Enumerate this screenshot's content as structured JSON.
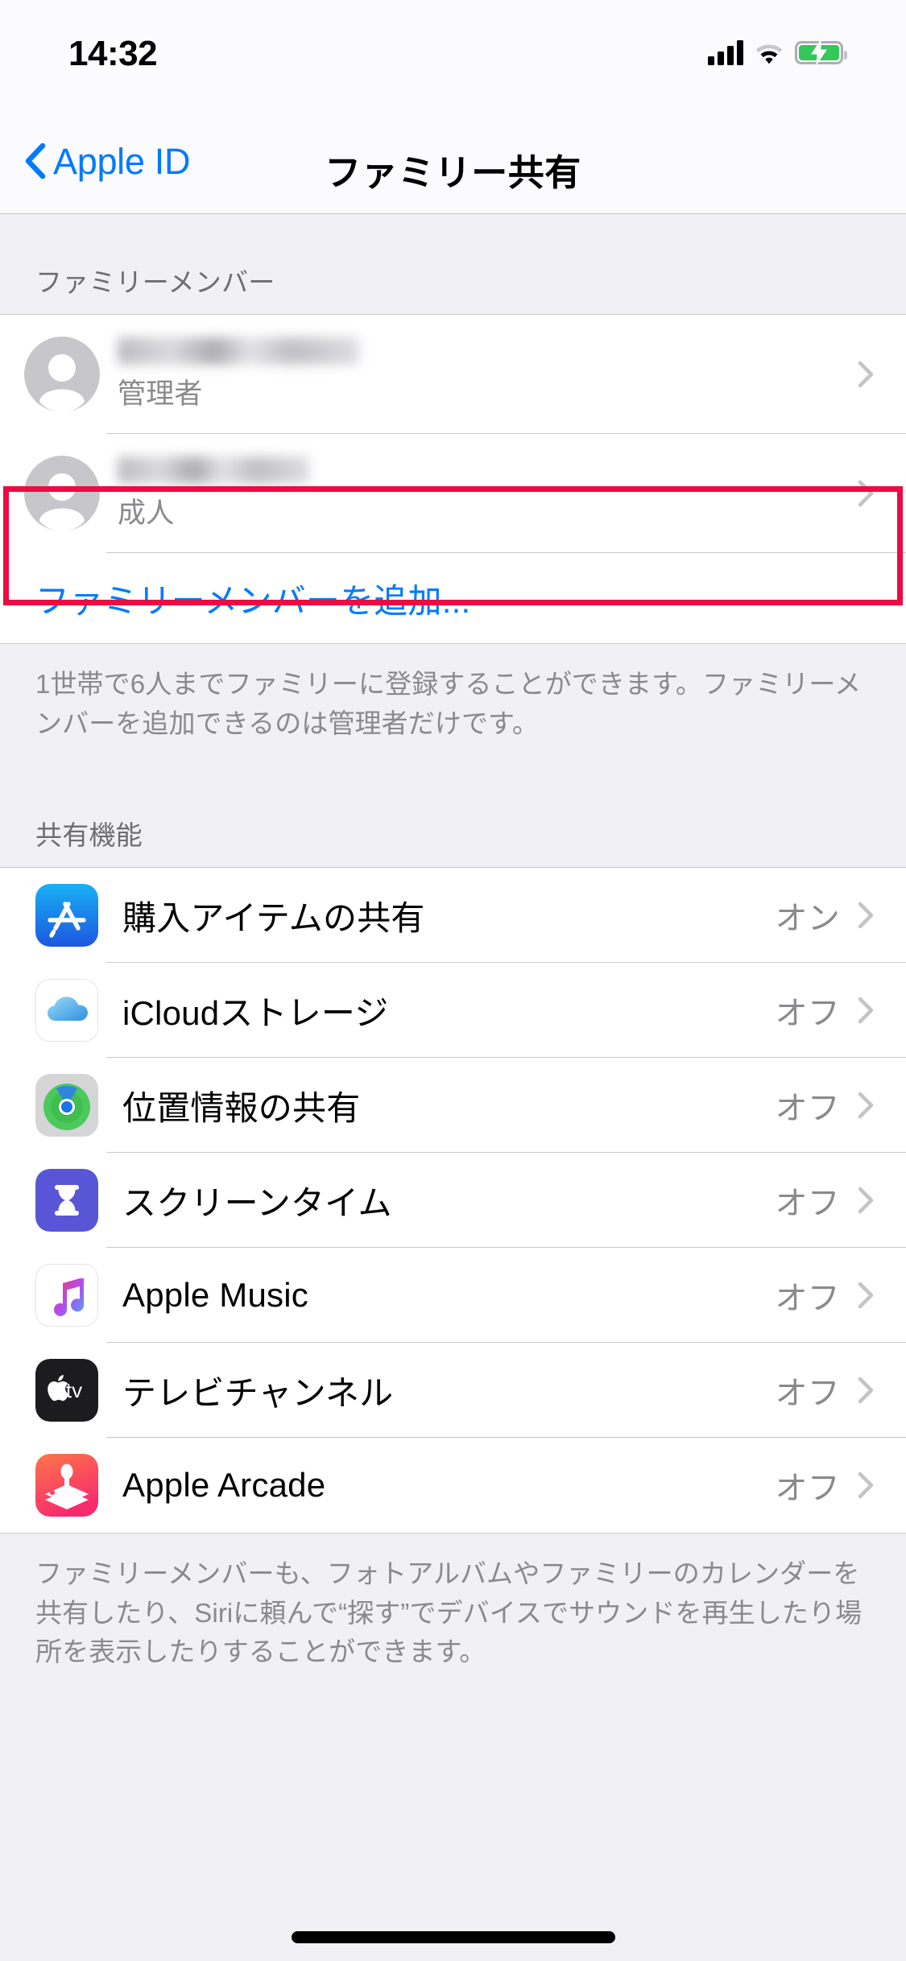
{
  "status_bar": {
    "time": "14:32",
    "signal_icon": "cellular-signal-icon",
    "wifi_icon": "wifi-icon",
    "battery_icon": "battery-charging-icon",
    "battery_charging": true
  },
  "nav": {
    "back_label": "Apple ID",
    "back_icon": "chevron-left-icon",
    "title": "ファミリー共有"
  },
  "members_section": {
    "header": "ファミリーメンバー",
    "members": [
      {
        "name_redacted": true,
        "role": "管理者",
        "avatar_icon": "person-avatar-icon",
        "chevron_icon": "chevron-right-icon",
        "highlighted": false
      },
      {
        "name_redacted": true,
        "role": "成人",
        "avatar_icon": "person-avatar-icon",
        "chevron_icon": "chevron-right-icon",
        "highlighted": true
      }
    ],
    "add_member_label": "ファミリーメンバーを追加...",
    "footer": "1世帯で6人までファミリーに登録することができます。ファミリーメンバーを追加できるのは管理者だけです。"
  },
  "features_section": {
    "header": "共有機能",
    "rows": [
      {
        "label": "購入アイテムの共有",
        "value": "オン",
        "icon": "app-store-icon",
        "chevron_icon": "chevron-right-icon"
      },
      {
        "label": "iCloudストレージ",
        "value": "オフ",
        "icon": "icloud-icon",
        "chevron_icon": "chevron-right-icon"
      },
      {
        "label": "位置情報の共有",
        "value": "オフ",
        "icon": "find-my-icon",
        "chevron_icon": "chevron-right-icon"
      },
      {
        "label": "スクリーンタイム",
        "value": "オフ",
        "icon": "screen-time-icon",
        "chevron_icon": "chevron-right-icon"
      },
      {
        "label": "Apple Music",
        "value": "オフ",
        "icon": "apple-music-icon",
        "chevron_icon": "chevron-right-icon"
      },
      {
        "label": "テレビチャンネル",
        "value": "オフ",
        "icon": "apple-tv-icon",
        "chevron_icon": "chevron-right-icon"
      },
      {
        "label": "Apple Arcade",
        "value": "オフ",
        "icon": "apple-arcade-icon",
        "chevron_icon": "chevron-right-icon"
      }
    ],
    "footer": "ファミリーメンバーも、フォトアルバムやファミリーのカレンダーを共有したり、Siriに頼んで“探す”でデバイスでサウンドを再生したり場所を表示したりすることができます。"
  },
  "annotation": {
    "highlight_color": "#ec0b43",
    "highlight_target": "成人"
  },
  "colors": {
    "accent_blue": "#007aff",
    "group_background": "#f1f1f5",
    "cell_background": "#ffffff",
    "secondary_text": "#8a8a8e"
  }
}
